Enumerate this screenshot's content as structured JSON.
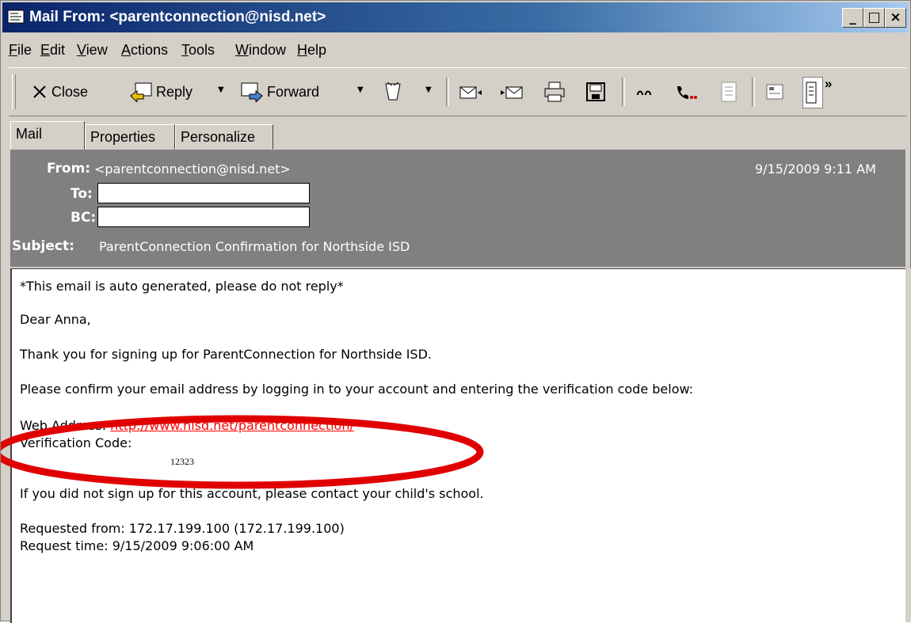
{
  "window": {
    "title": "Mail From: <parentconnection@nisd.net>",
    "controls": {
      "minimize": "_",
      "maximize": "□",
      "close": "×"
    }
  },
  "menu": {
    "items": [
      {
        "label": "File",
        "key": "F"
      },
      {
        "label": "Edit",
        "key": "E"
      },
      {
        "label": "View",
        "key": "V"
      },
      {
        "label": "Actions",
        "key": "A"
      },
      {
        "label": "Tools",
        "key": "T"
      },
      {
        "label": "Window",
        "key": "W"
      },
      {
        "label": "Help",
        "key": "H"
      }
    ]
  },
  "toolbar": {
    "close_label": "Close",
    "reply_label": "Reply",
    "forward_label": "Forward",
    "overflow": "»"
  },
  "tabs": [
    {
      "label": "Mail",
      "active": true
    },
    {
      "label": "Properties",
      "active": false
    },
    {
      "label": "Personalize",
      "active": false
    }
  ],
  "header": {
    "from_label": "From:",
    "from_value": "<parentconnection@nisd.net>",
    "date": "9/15/2009 9:11 AM",
    "to_label": "To:",
    "bc_label": "BC:",
    "subject_label": "Subject:",
    "subject_value": "ParentConnection Confirmation for Northside ISD"
  },
  "message": {
    "auto_note": "*This email is auto generated, please do not reply*",
    "greeting": "Dear Anna,",
    "thanks": "Thank you for signing up for ParentConnection for Northside ISD.",
    "instruction": "Please confirm your email address by logging in to your account and entering the verification code below:",
    "web_address_label": "Web Address:",
    "web_address_link": "http://www.nisd.net/parentconnection/",
    "verification_label": "Verification Code:",
    "verification_code": "12323",
    "contact_note": "If you did not sign up for this account, please contact your child's school.",
    "requested_from": "Requested from: 172.17.199.100 (172.17.199.100)",
    "request_time": "Request time: 9/15/2009 9:06:00 AM"
  },
  "colors": {
    "annotation_ellipse": "#e00000",
    "link": "#ff0000",
    "header_bg": "#808080"
  }
}
